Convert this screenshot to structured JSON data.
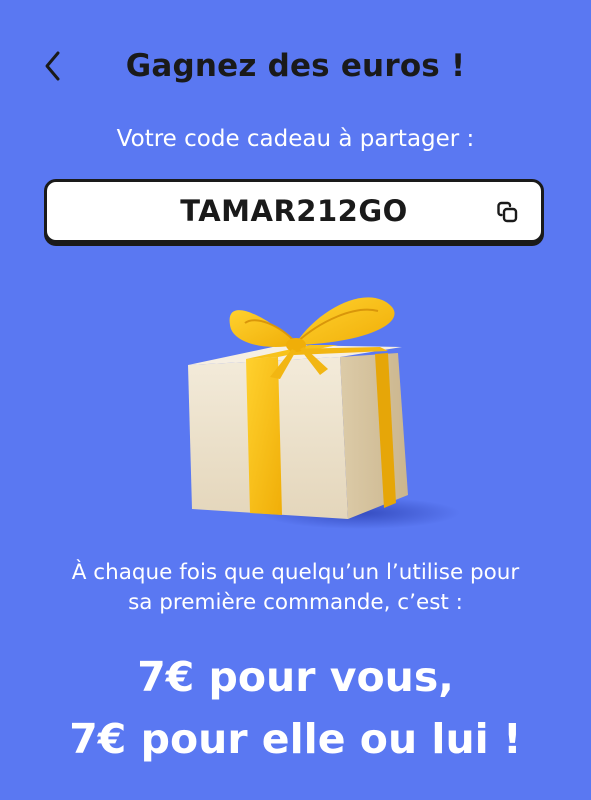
{
  "header": {
    "back_icon": "chevron-left-icon",
    "title": "Gagnez des euros !"
  },
  "code_section": {
    "label": "Votre code cadeau à partager :",
    "code": "TAMAR212GO",
    "copy_icon": "copy-icon"
  },
  "illustration": {
    "icon": "gift-box-icon",
    "box_color": "#eadfca",
    "ribbon_color": "#f7c21b"
  },
  "description": {
    "line1": "À chaque fois que quelqu’un l’utilise pour",
    "line2": "sa première commande, c’est :"
  },
  "promo": {
    "line1": "7€ pour vous,",
    "line2": "7€ pour elle ou lui !"
  },
  "colors": {
    "background": "#5a78f2",
    "text_dark": "#1a1a1a",
    "text_light": "#ffffff"
  }
}
